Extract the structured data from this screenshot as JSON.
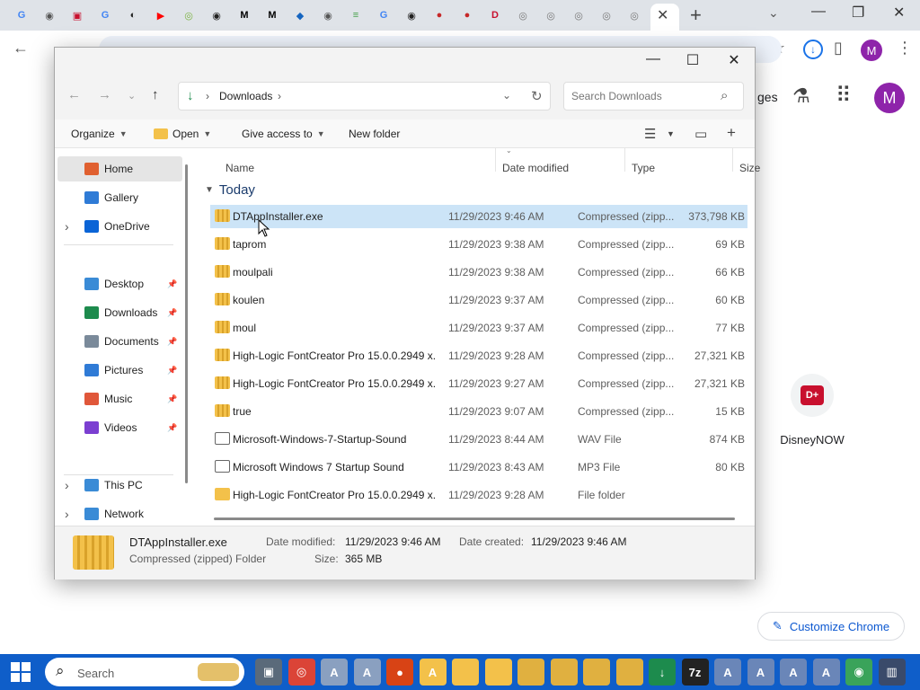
{
  "chrome": {
    "tab_favicons": [
      {
        "icon": "google-icon",
        "glyph": "G",
        "color": "#4285f4"
      },
      {
        "icon": "globe-icon",
        "glyph": "◉",
        "color": "#555555"
      },
      {
        "icon": "app-icon",
        "glyph": "▣",
        "color": "#c8102e"
      },
      {
        "icon": "google-icon",
        "glyph": "G",
        "color": "#4285f4"
      },
      {
        "icon": "app-icon",
        "glyph": "◐",
        "color": "#222222"
      },
      {
        "icon": "youtube-icon",
        "glyph": "▶",
        "color": "#ff0000"
      },
      {
        "icon": "app-icon",
        "glyph": "◎",
        "color": "#7cb342"
      },
      {
        "icon": "app-icon",
        "glyph": "◉",
        "color": "#222222"
      },
      {
        "icon": "medium-icon",
        "glyph": "M",
        "color": "#000000"
      },
      {
        "icon": "medium-icon",
        "glyph": "M",
        "color": "#000000"
      },
      {
        "icon": "app-icon",
        "glyph": "◆",
        "color": "#1565c0"
      },
      {
        "icon": "globe-icon",
        "glyph": "◉",
        "color": "#555555"
      },
      {
        "icon": "app-icon",
        "glyph": "≡",
        "color": "#43a047"
      },
      {
        "icon": "google-icon",
        "glyph": "G",
        "color": "#4285f4"
      },
      {
        "icon": "app-icon",
        "glyph": "◉",
        "color": "#222222"
      },
      {
        "icon": "app-icon",
        "glyph": "●",
        "color": "#c62828"
      },
      {
        "icon": "app-icon",
        "glyph": "●",
        "color": "#c62828"
      },
      {
        "icon": "disney-icon",
        "glyph": "D",
        "color": "#c8102e"
      },
      {
        "icon": "chrome-icon",
        "glyph": "◎",
        "color": "#777777"
      },
      {
        "icon": "chrome-icon",
        "glyph": "◎",
        "color": "#777777"
      },
      {
        "icon": "chrome-icon",
        "glyph": "◎",
        "color": "#777777"
      },
      {
        "icon": "chrome-icon",
        "glyph": "◎",
        "color": "#777777"
      },
      {
        "icon": "chrome-icon",
        "glyph": "◎",
        "color": "#777777"
      }
    ],
    "ntp_images_label": "ges",
    "avatar_letter": "M",
    "shortcut_label": "DisneyNOW",
    "customize_label": "Customize Chrome"
  },
  "explorer": {
    "address": "Downloads",
    "search_placeholder": "Search Downloads",
    "commands": {
      "organize": "Organize",
      "open": "Open",
      "give_access": "Give access to",
      "new_folder": "New folder"
    },
    "nav_items": [
      {
        "label": "Home",
        "icon": "home-icon",
        "color": "#e06030",
        "expand": false,
        "pin": false,
        "selected": true
      },
      {
        "label": "Gallery",
        "icon": "gallery-icon",
        "color": "#2f7bd6",
        "expand": false,
        "pin": false,
        "selected": false
      },
      {
        "label": "OneDrive",
        "icon": "cloud-icon",
        "color": "#0a64d6",
        "expand": true,
        "pin": false,
        "selected": false
      },
      {
        "label": "Desktop",
        "icon": "desktop-icon",
        "color": "#3a8bd6",
        "expand": false,
        "pin": true,
        "selected": false
      },
      {
        "label": "Downloads",
        "icon": "download-icon",
        "color": "#1d8b4d",
        "expand": false,
        "pin": true,
        "selected": false
      },
      {
        "label": "Documents",
        "icon": "documents-icon",
        "color": "#7a8a9a",
        "expand": false,
        "pin": true,
        "selected": false
      },
      {
        "label": "Pictures",
        "icon": "pictures-icon",
        "color": "#2f7bd6",
        "expand": false,
        "pin": true,
        "selected": false
      },
      {
        "label": "Music",
        "icon": "music-icon",
        "color": "#e0573a",
        "expand": false,
        "pin": true,
        "selected": false
      },
      {
        "label": "Videos",
        "icon": "videos-icon",
        "color": "#7b3fd1",
        "expand": false,
        "pin": true,
        "selected": false
      },
      {
        "label": "This PC",
        "icon": "computer-icon",
        "color": "#3a8bd6",
        "expand": true,
        "pin": false,
        "selected": false
      },
      {
        "label": "Network",
        "icon": "network-icon",
        "color": "#3a8bd6",
        "expand": true,
        "pin": false,
        "selected": false
      }
    ],
    "columns": {
      "name": "Name",
      "date": "Date modified",
      "type": "Type",
      "size": "Size"
    },
    "group_label": "Today",
    "files": [
      {
        "name": "DTAppInstaller.exe",
        "date": "11/29/2023 9:46 AM",
        "type": "Compressed (zipp...",
        "size": "373,798 KB",
        "kind": "zip",
        "selected": true
      },
      {
        "name": "taprom",
        "date": "11/29/2023 9:38 AM",
        "type": "Compressed (zipp...",
        "size": "69 KB",
        "kind": "zip",
        "selected": false
      },
      {
        "name": "moulpali",
        "date": "11/29/2023 9:38 AM",
        "type": "Compressed (zipp...",
        "size": "66 KB",
        "kind": "zip",
        "selected": false
      },
      {
        "name": "koulen",
        "date": "11/29/2023 9:37 AM",
        "type": "Compressed (zipp...",
        "size": "60 KB",
        "kind": "zip",
        "selected": false
      },
      {
        "name": "moul",
        "date": "11/29/2023 9:37 AM",
        "type": "Compressed (zipp...",
        "size": "77 KB",
        "kind": "zip",
        "selected": false
      },
      {
        "name": "High-Logic FontCreator Pro 15.0.0.2949 x...",
        "date": "11/29/2023 9:28 AM",
        "type": "Compressed (zipp...",
        "size": "27,321 KB",
        "kind": "zip",
        "selected": false
      },
      {
        "name": "High-Logic FontCreator Pro 15.0.0.2949 x...",
        "date": "11/29/2023 9:27 AM",
        "type": "Compressed (zipp...",
        "size": "27,321 KB",
        "kind": "zip",
        "selected": false
      },
      {
        "name": "true",
        "date": "11/29/2023 9:07 AM",
        "type": "Compressed (zipp...",
        "size": "15 KB",
        "kind": "zip",
        "selected": false
      },
      {
        "name": "Microsoft-Windows-7-Startup-Sound",
        "date": "11/29/2023 8:44 AM",
        "type": "WAV File",
        "size": "874 KB",
        "kind": "audio",
        "selected": false
      },
      {
        "name": "Microsoft Windows 7 Startup Sound",
        "date": "11/29/2023 8:43 AM",
        "type": "MP3 File",
        "size": "80 KB",
        "kind": "audio",
        "selected": false
      },
      {
        "name": "High-Logic FontCreator Pro 15.0.0.2949 x...",
        "date": "11/29/2023 9:28 AM",
        "type": "File folder",
        "size": "",
        "kind": "folder",
        "selected": false
      }
    ],
    "details": {
      "name": "DTAppInstaller.exe",
      "kind": "Compressed (zipped) Folder",
      "modified_label": "Date modified:",
      "modified": "11/29/2023 9:46 AM",
      "created_label": "Date created:",
      "created": "11/29/2023 9:46 AM",
      "size_label": "Size:",
      "size": "365 MB"
    }
  },
  "taskbar": {
    "search_placeholder": "Search",
    "apps": [
      {
        "icon": "task-view-icon",
        "glyph": "▣",
        "color": "#5a6a7a"
      },
      {
        "icon": "chrome-icon",
        "glyph": "◎",
        "color": "#db4437"
      },
      {
        "icon": "fontcreator-icon",
        "glyph": "A",
        "color": "#8aa0c0"
      },
      {
        "icon": "fontcreator-icon",
        "glyph": "A",
        "color": "#8aa0c0"
      },
      {
        "icon": "maps-pin-icon",
        "glyph": "●",
        "color": "#d84315"
      },
      {
        "icon": "file-explorer-icon",
        "glyph": "A",
        "color": "#f3c14a"
      },
      {
        "icon": "folder-icon",
        "glyph": "",
        "color": "#f3c14a"
      },
      {
        "icon": "folder-icon",
        "glyph": "",
        "color": "#f3c14a"
      },
      {
        "icon": "zip-folder-icon",
        "glyph": "",
        "color": "#e0b040"
      },
      {
        "icon": "zip-folder-icon",
        "glyph": "",
        "color": "#e0b040"
      },
      {
        "icon": "zip-folder-icon",
        "glyph": "",
        "color": "#e0b040"
      },
      {
        "icon": "zip-folder-icon",
        "glyph": "",
        "color": "#e0b040"
      },
      {
        "icon": "download-icon",
        "glyph": "↓",
        "color": "#1d8b4d"
      },
      {
        "icon": "7zip-icon",
        "glyph": "7z",
        "color": "#222222"
      },
      {
        "icon": "font-file-icon",
        "glyph": "A",
        "color": "#6a86b8"
      },
      {
        "icon": "font-file-icon",
        "glyph": "A",
        "color": "#6a86b8"
      },
      {
        "icon": "font-file-icon",
        "glyph": "A",
        "color": "#6a86b8"
      },
      {
        "icon": "font-file-icon",
        "glyph": "A",
        "color": "#6a86b8"
      },
      {
        "icon": "network-globe-icon",
        "glyph": "◉",
        "color": "#3aa35a"
      },
      {
        "icon": "notebook-icon",
        "glyph": "▥",
        "color": "#3a4a6a"
      }
    ]
  }
}
